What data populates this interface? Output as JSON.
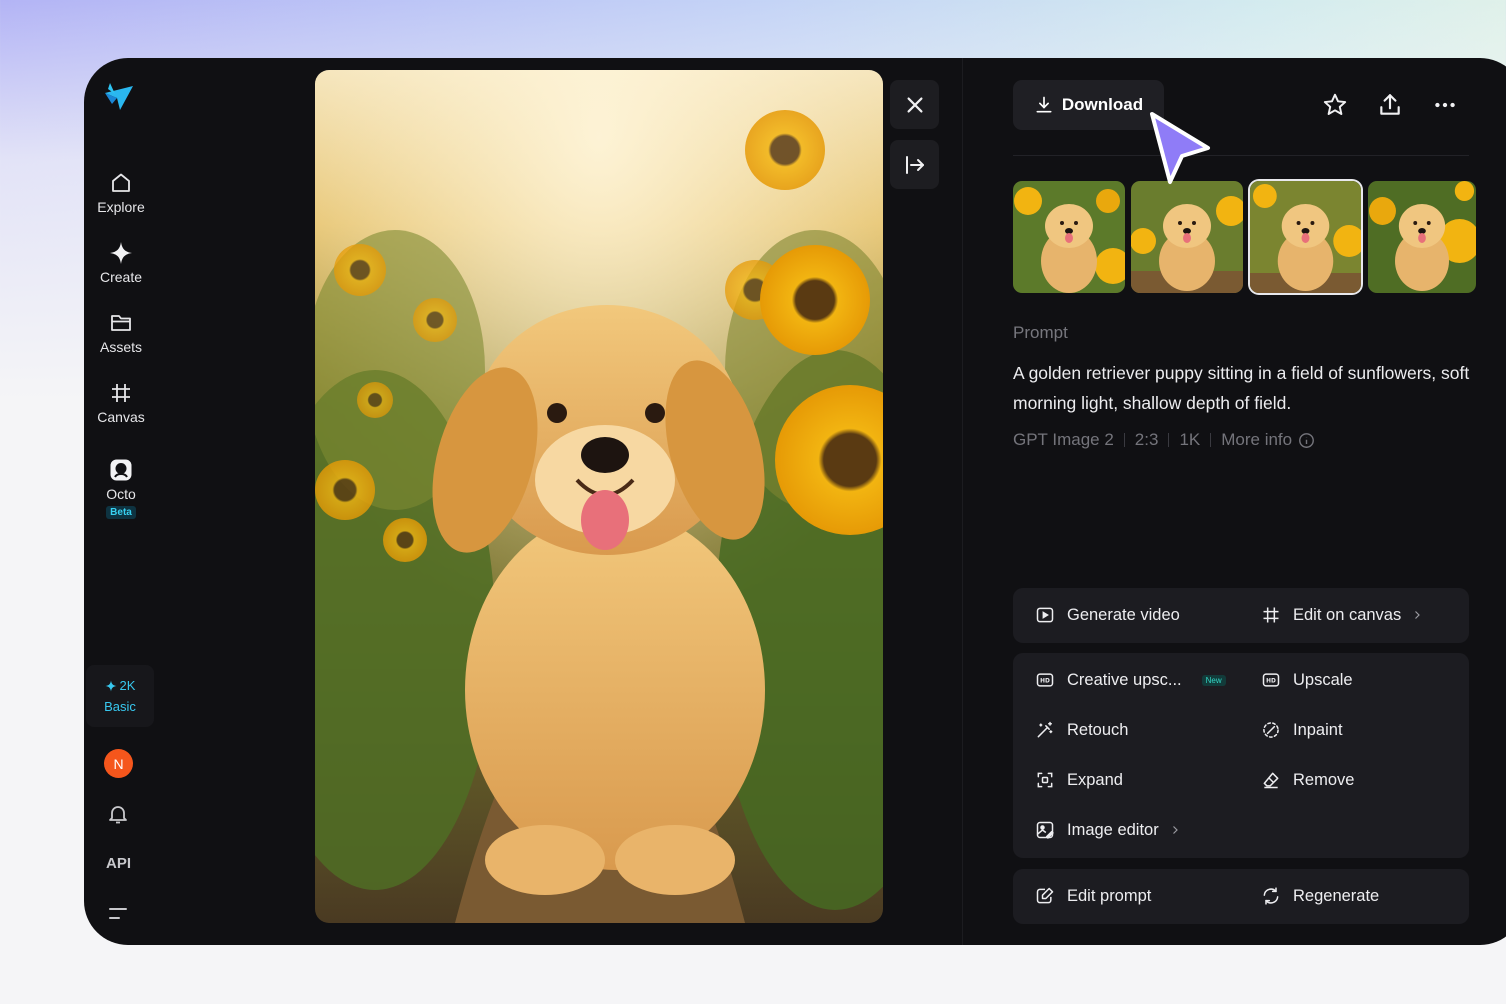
{
  "sidebar": {
    "nav": [
      {
        "label": "Explore",
        "icon": "home-icon"
      },
      {
        "label": "Create",
        "icon": "sparkle-icon"
      },
      {
        "label": "Assets",
        "icon": "folder-icon"
      },
      {
        "label": "Canvas",
        "icon": "canvas-grid-icon"
      },
      {
        "label": "Octo",
        "icon": "octo-icon"
      }
    ],
    "octo_badge": "Beta",
    "credits": {
      "amount": "2K",
      "plan": "Basic"
    },
    "avatar_initial": "N",
    "api_label": "API"
  },
  "toolbar": {
    "download_label": "Download"
  },
  "prompt": {
    "label": "Prompt",
    "text": "A golden retriever puppy sitting in a field of sunflowers, soft morning light, shallow depth of field.",
    "meta": [
      "GPT Image 2",
      "2:3",
      "1K",
      "More info"
    ]
  },
  "thumbnails": {
    "count": 4,
    "selected_index": 2
  },
  "actions": {
    "primary": [
      {
        "label": "Generate video",
        "icon": "play-icon"
      },
      {
        "label": "Edit on canvas",
        "icon": "canvas-grid-icon"
      }
    ],
    "tools": [
      {
        "label": "Creative upsc...",
        "icon": "hd-icon",
        "badge": "New"
      },
      {
        "label": "Upscale",
        "icon": "hd-icon"
      },
      {
        "label": "Retouch",
        "icon": "magic-wand-icon"
      },
      {
        "label": "Inpaint",
        "icon": "inpaint-icon"
      },
      {
        "label": "Expand",
        "icon": "expand-icon"
      },
      {
        "label": "Remove",
        "icon": "eraser-icon"
      },
      {
        "label": "Image editor",
        "icon": "image-edit-icon"
      }
    ],
    "secondary": [
      {
        "label": "Edit prompt",
        "icon": "edit-icon"
      },
      {
        "label": "Regenerate",
        "icon": "refresh-icon"
      }
    ]
  },
  "colors": {
    "accent": "#38c8ef",
    "avatar": "#f5561c",
    "cursor": "#8f7cf7"
  }
}
